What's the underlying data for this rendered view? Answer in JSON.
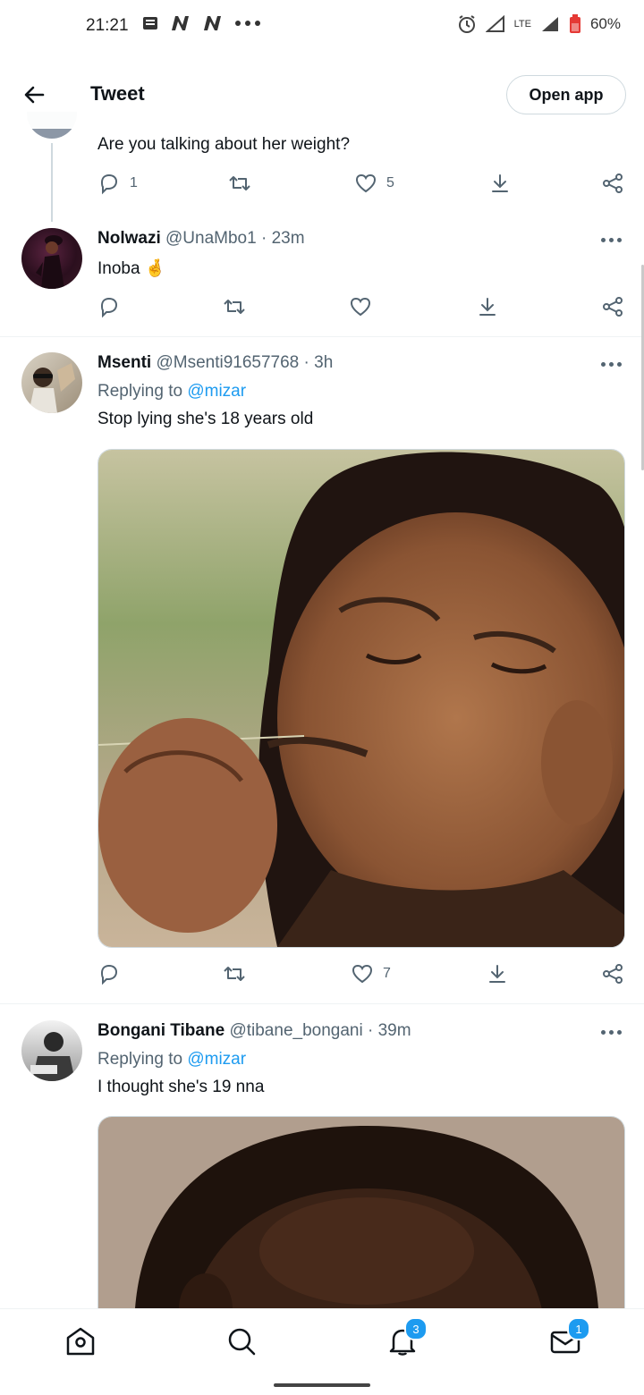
{
  "status": {
    "time": "21:21",
    "battery": "60%",
    "network": "LTE"
  },
  "header": {
    "title": "Tweet",
    "open_app_label": "Open app"
  },
  "tweets": [
    {
      "text": "Are you talking about her weight?",
      "reply_count": "1",
      "like_count": "5"
    },
    {
      "name": "Nolwazi",
      "handle": "@UnaMbo1",
      "time": "· 23m",
      "text": "Inoba 🤞"
    },
    {
      "name": "Msenti",
      "handle": "@Msenti91657768",
      "time": "· 3h",
      "replying_prefix": "Replying to",
      "replying_handle": "@mizar",
      "text": "Stop lying she's 18 years old",
      "like_count": "7"
    },
    {
      "name": "Bongani Tibane",
      "handle": "@tibane_bongani",
      "time": "· 39m",
      "replying_prefix": "Replying to",
      "replying_handle": "@mizar",
      "text": "I thought she's 19 nna"
    }
  ],
  "nav": {
    "notifications_badge": "3",
    "messages_badge": "1"
  },
  "colors": {
    "accent": "#1d9bf0",
    "secondary_text": "#536471",
    "divider": "#eff3f4"
  }
}
